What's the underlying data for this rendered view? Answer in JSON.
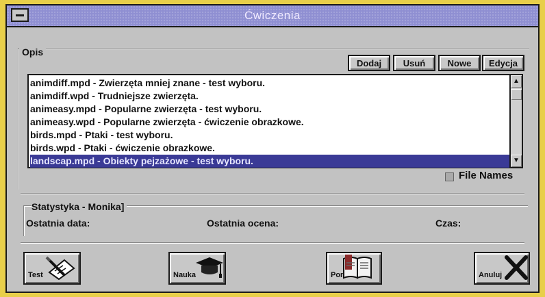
{
  "window": {
    "title": "Ćwiczenia"
  },
  "opis": {
    "label": "Opis",
    "buttons": [
      "Dodaj",
      "Usuń",
      "Nowe",
      "Edycja"
    ]
  },
  "list": {
    "items": [
      "animdiff.mpd - Zwierzęta mniej znane - test wyboru.",
      "animdiff.wpd - Trudniejsze zwierzęta.",
      "animeasy.mpd - Popularne zwierzęta - test wyboru.",
      "animeasy.wpd - Popularne zwierzęta - ćwiczenie obrazkowe.",
      "birds.mpd - Ptaki - test wyboru.",
      "birds.wpd - Ptaki - ćwiczenie obrazkowe.",
      "landscap.mpd - Obiekty pejzażowe - test wyboru."
    ],
    "selected_index": 6
  },
  "file_names": {
    "label": "File Names",
    "checked": false
  },
  "statystyka": {
    "title": "Statystyka - Monika]",
    "last_date": "Ostatnia data:",
    "last_score": "Ostatnia ocena:",
    "time": "Czas:"
  },
  "actions": {
    "test": "Test",
    "nauka": "Nauka",
    "pomoc": "Pomoc",
    "anuluj": "Anuluj"
  },
  "colors": {
    "titlebar": "#8f8fd2",
    "selection": "#3a3a96",
    "background": "#e8cf4a",
    "window": "#c2c2c2"
  }
}
